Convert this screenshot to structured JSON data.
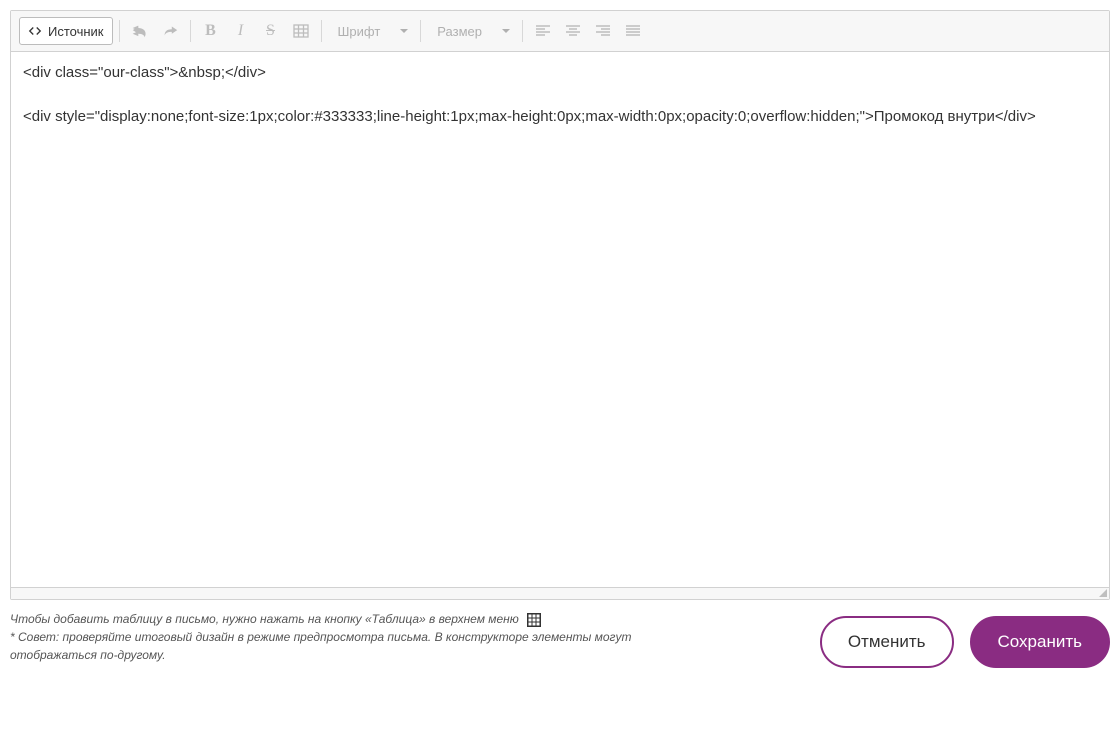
{
  "toolbar": {
    "source_label": "Источник",
    "font_label": "Шрифт",
    "size_label": "Размер"
  },
  "editor": {
    "content": "<div class=\"our-class\">&nbsp;</div>\n\n<div style=\"display:none;font-size:1px;color:#333333;line-height:1px;max-height:0px;max-width:0px;opacity:0;overflow:hidden;\">Промокод внутри</div>"
  },
  "tips": {
    "line1": "Чтобы добавить таблицу в письмо, нужно нажать на кнопку «Таблица» в верхнем меню",
    "line2": "* Совет: проверяйте итоговый дизайн в режиме предпросмотра письма. В конструкторе элементы могут отображаться по-другому."
  },
  "buttons": {
    "cancel": "Отменить",
    "save": "Сохранить"
  }
}
